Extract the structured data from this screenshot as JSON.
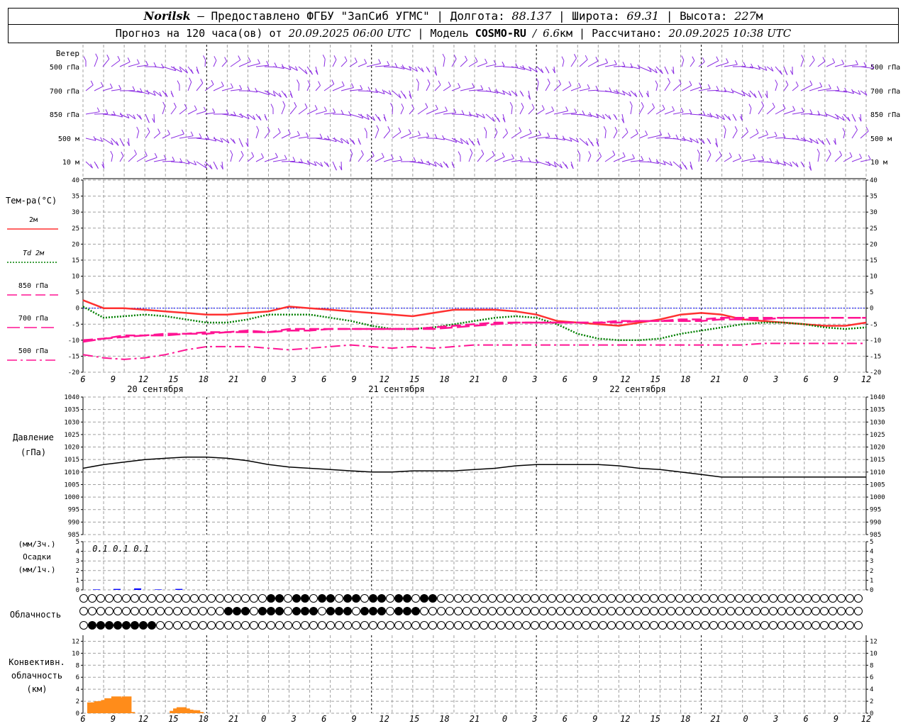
{
  "header": {
    "station": "Norilsk",
    "dash": "–",
    "provider": "Предоставлено ФГБУ \"ЗапСиб УГМС\"",
    "sep": "|",
    "lon_label": "Долгота:",
    "lon_value": "88.137",
    "lat_label": "Широта:",
    "lat_value": "69.31",
    "alt_label": "Высота:",
    "alt_value": "227",
    "alt_unit": "м"
  },
  "subheader": {
    "forecast_text": "Прогноз на 120 часа(ов) от",
    "forecast_start": "20.09.2025 06:00 UTC",
    "model_label": "Модель",
    "model_name": "COSMO-RU",
    "model_slash": "/",
    "model_res": "6.6",
    "model_res_unit": "км",
    "computed_label": "Рассчитано:",
    "computed_time": "20.09.2025 10:38 UTC"
  },
  "colors": {
    "wind": "#8a2be2",
    "t2m": "#ff3030",
    "td2m": "#008000",
    "t850": "#ff1493",
    "pressure": "#000000",
    "precip": "#0000ff",
    "convective": "#ff8c1a",
    "grid": "#a0a0a0"
  },
  "chart_data": [
    {
      "type": "wind_barbs",
      "panel": "wind",
      "title": "Ветер",
      "levels": [
        "500 гПа",
        "700 гПа",
        "850 гПа",
        "500 м",
        "10 м"
      ],
      "x_hours": [
        0,
        120
      ]
    },
    {
      "type": "line",
      "panel": "temperature",
      "ylabel": "Тем-ра(°С)",
      "ylim": [
        -20,
        40
      ],
      "yticks": [
        -20,
        -15,
        -10,
        -5,
        0,
        5,
        10,
        15,
        20,
        25,
        30,
        35,
        40
      ],
      "x_unit": "hours from 20.09.2025 06:00 UTC",
      "series": [
        {
          "name": "2м",
          "key": "t2m",
          "style": "solid",
          "x": [
            0,
            3,
            6,
            9,
            12,
            15,
            18,
            21,
            24,
            27,
            30,
            33,
            36,
            39,
            42,
            45,
            48,
            51,
            54,
            57,
            60,
            63,
            66,
            69,
            72,
            75,
            78,
            81,
            84,
            87,
            90,
            93,
            96,
            99,
            102,
            105,
            108,
            111,
            114
          ],
          "values": [
            2.5,
            0.0,
            0.0,
            -0.5,
            -1.0,
            -1.5,
            -2.0,
            -2.0,
            -1.5,
            -1.0,
            0.5,
            0.0,
            -0.5,
            -1.0,
            -1.5,
            -2.0,
            -2.5,
            -1.5,
            -0.5,
            -0.5,
            -0.5,
            -1.0,
            -2.0,
            -4.0,
            -4.5,
            -5.0,
            -5.5,
            -4.5,
            -3.5,
            -2.0,
            -1.5,
            -2.0,
            -3.5,
            -4.0,
            -4.5,
            -5.0,
            -5.5,
            -5.5,
            -4.5
          ]
        },
        {
          "name": "Td 2м",
          "key": "td2m",
          "style": "dotted",
          "x": [
            0,
            3,
            6,
            9,
            12,
            15,
            18,
            21,
            24,
            27,
            30,
            33,
            36,
            39,
            42,
            45,
            48,
            51,
            54,
            57,
            60,
            63,
            66,
            69,
            72,
            75,
            78,
            81,
            84,
            87,
            90,
            93,
            96,
            99,
            102,
            105,
            108,
            111,
            114
          ],
          "values": [
            0.5,
            -3.0,
            -2.5,
            -2.0,
            -2.5,
            -3.5,
            -4.5,
            -4.5,
            -3.5,
            -2.0,
            -2.0,
            -2.0,
            -3.0,
            -4.0,
            -5.5,
            -6.5,
            -6.5,
            -6.0,
            -5.0,
            -4.0,
            -3.0,
            -2.5,
            -3.0,
            -5.0,
            -8.0,
            -9.5,
            -10.0,
            -10.0,
            -9.5,
            -8.0,
            -7.0,
            -6.0,
            -5.0,
            -4.5,
            -4.5,
            -5.0,
            -6.0,
            -6.5,
            -6.0
          ]
        },
        {
          "name": "850 гПа",
          "key": "t850",
          "style": "dashed",
          "x": [
            0,
            3,
            6,
            9,
            12,
            15,
            18,
            21,
            24,
            27,
            30,
            33,
            36,
            39,
            42,
            45,
            48,
            51,
            54,
            57,
            60,
            63,
            66,
            69,
            72,
            75,
            78,
            81,
            84,
            87,
            90,
            93,
            96,
            99,
            102,
            105,
            108,
            111,
            114
          ],
          "values": [
            -10.0,
            -9.5,
            -8.5,
            -8.5,
            -8.0,
            -8.0,
            -7.5,
            -7.5,
            -7.0,
            -7.5,
            -6.5,
            -6.5,
            -6.5,
            -6.5,
            -6.5,
            -6.5,
            -6.5,
            -6.0,
            -5.5,
            -5.0,
            -4.5,
            -4.5,
            -4.5,
            -4.5,
            -4.5,
            -4.5,
            -4.0,
            -4.0,
            -4.0,
            -3.5,
            -3.5,
            -3.0,
            -3.0,
            -3.0,
            -3.0,
            -3.0,
            -3.0,
            -3.0,
            -3.0
          ]
        },
        {
          "name": "700 гПа",
          "key": "t700",
          "style": "longdash",
          "x": [
            0,
            3,
            6,
            9,
            12,
            15,
            18,
            21,
            24,
            27,
            30,
            33,
            36,
            39,
            42,
            45,
            48,
            51,
            54,
            57,
            60,
            63,
            66,
            69,
            72,
            75,
            78,
            81,
            84,
            87,
            90,
            93,
            96,
            99,
            102,
            105,
            108,
            111,
            114
          ],
          "values": [
            -10.5,
            -9.5,
            -9.0,
            -8.5,
            -8.5,
            -8.0,
            -8.0,
            -7.5,
            -7.5,
            -7.5,
            -7.0,
            -7.0,
            -6.5,
            -6.5,
            -6.5,
            -6.5,
            -6.5,
            -6.5,
            -6.0,
            -5.5,
            -5.0,
            -4.5,
            -4.5,
            -4.5,
            -4.5,
            -4.5,
            -4.5,
            -4.0,
            -4.0,
            -4.0,
            -4.0,
            -3.5,
            -3.5,
            -3.5,
            -3.0,
            -3.0,
            -3.0,
            -3.0,
            -3.0
          ]
        },
        {
          "name": "500 гПа",
          "key": "t500",
          "style": "dashdot",
          "x": [
            0,
            3,
            6,
            9,
            12,
            15,
            18,
            21,
            24,
            27,
            30,
            33,
            36,
            39,
            42,
            45,
            48,
            51,
            54,
            57,
            60,
            63,
            66,
            69,
            72,
            75,
            78,
            81,
            84,
            87,
            90,
            93,
            96,
            99,
            102,
            105,
            108,
            111,
            114
          ],
          "values": [
            -14.5,
            -15.5,
            -16.0,
            -15.5,
            -14.5,
            -13.0,
            -12.0,
            -12.0,
            -12.0,
            -12.5,
            -13.0,
            -12.5,
            -12.0,
            -11.5,
            -12.0,
            -12.5,
            -12.0,
            -12.5,
            -12.0,
            -11.5,
            -11.5,
            -11.5,
            -11.5,
            -11.5,
            -11.5,
            -11.5,
            -11.5,
            -11.5,
            -11.5,
            -11.5,
            -11.5,
            -11.5,
            -11.5,
            -11.0,
            -11.0,
            -11.0,
            -11.0,
            -11.0,
            -11.0
          ]
        }
      ]
    },
    {
      "type": "line",
      "panel": "pressure",
      "ylabel": "Давление",
      "ylabel2": "(гПа)",
      "ylim": [
        985,
        1040
      ],
      "yticks": [
        985,
        990,
        995,
        1000,
        1005,
        1010,
        1015,
        1020,
        1025,
        1030,
        1035,
        1040
      ],
      "series": [
        {
          "name": "Давление",
          "key": "pressure",
          "x": [
            0,
            3,
            6,
            9,
            12,
            15,
            18,
            21,
            24,
            27,
            30,
            33,
            36,
            39,
            42,
            45,
            48,
            51,
            54,
            57,
            60,
            63,
            66,
            69,
            72,
            75,
            78,
            81,
            84,
            87,
            90,
            93,
            96,
            99,
            102,
            105,
            108,
            111,
            114
          ],
          "values": [
            1011.5,
            1013.0,
            1014.0,
            1015.0,
            1015.5,
            1016.0,
            1016.0,
            1015.5,
            1014.5,
            1013.0,
            1012.0,
            1011.5,
            1011.0,
            1010.5,
            1010.0,
            1010.0,
            1010.5,
            1010.5,
            1010.5,
            1011.0,
            1011.5,
            1012.5,
            1013.0,
            1013.0,
            1013.0,
            1013.0,
            1012.5,
            1011.5,
            1011.0,
            1010.0,
            1009.0,
            1008.0,
            1008.0,
            1008.0,
            1008.0,
            1008.0,
            1008.0,
            1008.0,
            1008.0
          ]
        }
      ]
    },
    {
      "type": "bar",
      "panel": "precipitation",
      "ylabel": "Осадки",
      "unit_3h": "(мм/3ч.)",
      "unit_1h": "(мм/1ч.)",
      "ylim": [
        0,
        5
      ],
      "yticks": [
        0,
        1,
        2,
        3,
        4,
        5
      ],
      "x": [
        0,
        3,
        6,
        9,
        12
      ],
      "values": [
        0.05,
        0.1,
        0.15,
        0.05,
        0.1
      ],
      "labels": [
        {
          "hour": 3,
          "text": "0.1"
        },
        {
          "hour": 6,
          "text": "0.1"
        },
        {
          "hour": 9,
          "text": "0.1"
        }
      ]
    },
    {
      "type": "table",
      "panel": "clouds",
      "ylabel": "Облачность",
      "levels": [
        "high",
        "middle",
        "low"
      ]
    },
    {
      "type": "bar",
      "panel": "convective",
      "ylabel_lines": [
        "Конвективн.",
        "облачность",
        "(км)"
      ],
      "ylim": [
        0,
        13
      ],
      "yticks": [
        0,
        2,
        4,
        6,
        8,
        10,
        12
      ],
      "x": [
        0,
        1,
        2,
        3,
        4,
        5,
        6,
        7,
        8,
        9,
        10,
        11,
        12,
        13,
        14,
        15,
        24,
        25,
        26,
        27,
        28,
        29,
        30,
        31
      ],
      "values": [
        1.8,
        1.8,
        2.0,
        2.0,
        2.2,
        2.5,
        0.3,
        2.8,
        2.6,
        2.5,
        2.8,
        0.2,
        0,
        0,
        0,
        0,
        0.4,
        0.8,
        1.0,
        0.8,
        0.6,
        0.5,
        0.5,
        0.2
      ]
    }
  ],
  "time_axis": {
    "hour_labels": [
      "6",
      "9",
      "12",
      "15",
      "18",
      "21",
      "0",
      "3",
      "6",
      "9",
      "12",
      "15",
      "18",
      "21",
      "0",
      "3",
      "6",
      "9",
      "12",
      "15",
      "18",
      "21",
      "0",
      "3",
      "6",
      "9",
      "12"
    ],
    "day_labels": [
      "20 сентября",
      "21 сентября",
      "22 сентября"
    ]
  }
}
